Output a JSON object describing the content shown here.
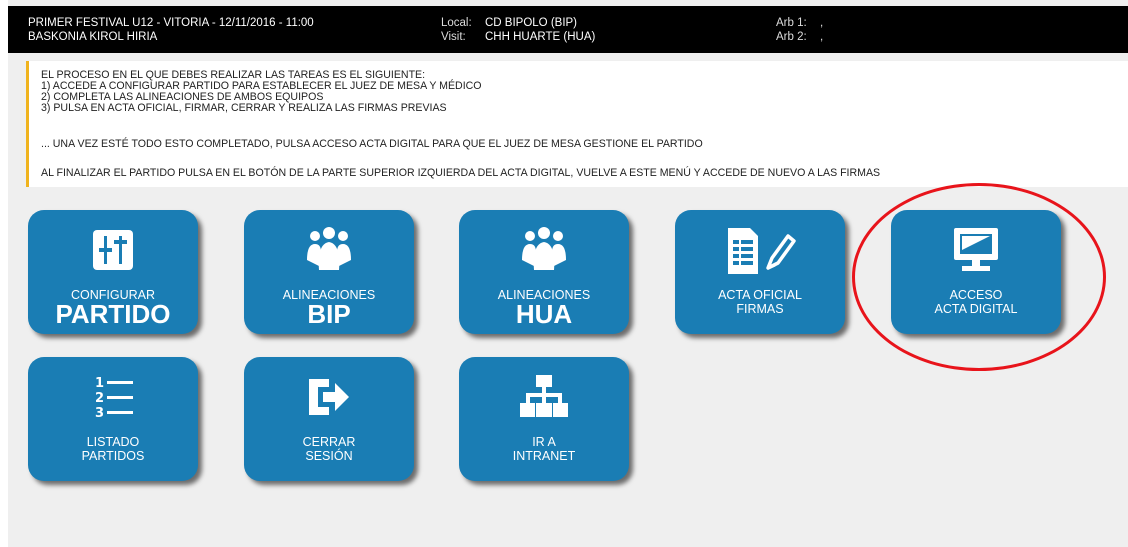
{
  "header": {
    "event": "PRIMER FESTIVAL U12 - VITORIA - 12/11/2016 - 11:00",
    "venue": "BASKONIA KIROL HIRIA",
    "local_label": "Local:",
    "local_value": "CD BIPOLO (BIP)",
    "visit_label": "Visit:",
    "visit_value": "CHH HUARTE (HUA)",
    "arb1_label": "Arb 1:",
    "arb1_value": ",",
    "arb2_label": "Arb 2:",
    "arb2_value": ","
  },
  "instructions": {
    "steps": [
      "EL PROCESO EN EL QUE DEBES REALIZAR LAS TAREAS ES EL SIGUIENTE:",
      "1) ACCEDE A CONFIGURAR PARTIDO PARA ESTABLECER EL JUEZ DE MESA Y MÉDICO",
      "2) COMPLETA LAS ALINEACIONES DE AMBOS EQUIPOS",
      "3) PULSA EN ACTA OFICIAL, FIRMAR, CERRAR Y REALIZA LAS FIRMAS PREVIAS"
    ],
    "line_completed": "... UNA VEZ ESTÉ TODO ESTO COMPLETADO, PULSA ACCESO ACTA DIGITAL PARA QUE EL JUEZ DE MESA GESTIONE EL PARTIDO",
    "line_finish": "AL FINALIZAR EL PARTIDO PULSA EN EL BOTÓN DE LA PARTE SUPERIOR IZQUIERDA DEL ACTA DIGITAL, VUELVE A ESTE MENÚ Y ACCEDE DE NUEVO A LAS FIRMAS"
  },
  "tiles": {
    "configurar": {
      "small": "CONFIGURAR",
      "big": "PARTIDO",
      "icon": "settings-sliders-icon"
    },
    "alin_bip": {
      "small": "ALINEACIONES",
      "big": "BIP",
      "icon": "team-group-icon"
    },
    "alin_hua": {
      "small": "ALINEACIONES",
      "big": "HUA",
      "icon": "team-group-icon"
    },
    "acta_oficial": {
      "line1": "ACTA OFICIAL",
      "line2": "FIRMAS",
      "icon": "document-pencil-icon"
    },
    "acta_digital": {
      "line1": "ACCESO",
      "line2": "ACTA DIGITAL",
      "icon": "monitor-icon"
    },
    "listado": {
      "line1": "LISTADO",
      "line2": "PARTIDOS",
      "icon": "numbered-list-icon"
    },
    "cerrar": {
      "line1": "CERRAR",
      "line2": "SESIÓN",
      "icon": "logout-icon"
    },
    "intranet": {
      "line1": "IR A",
      "line2": "INTRANET",
      "icon": "sitemap-icon"
    }
  },
  "colors": {
    "tile": "#1a7db4",
    "header_bg": "#000000",
    "accent_border": "#f0b31d",
    "highlight": "#e8141b"
  }
}
